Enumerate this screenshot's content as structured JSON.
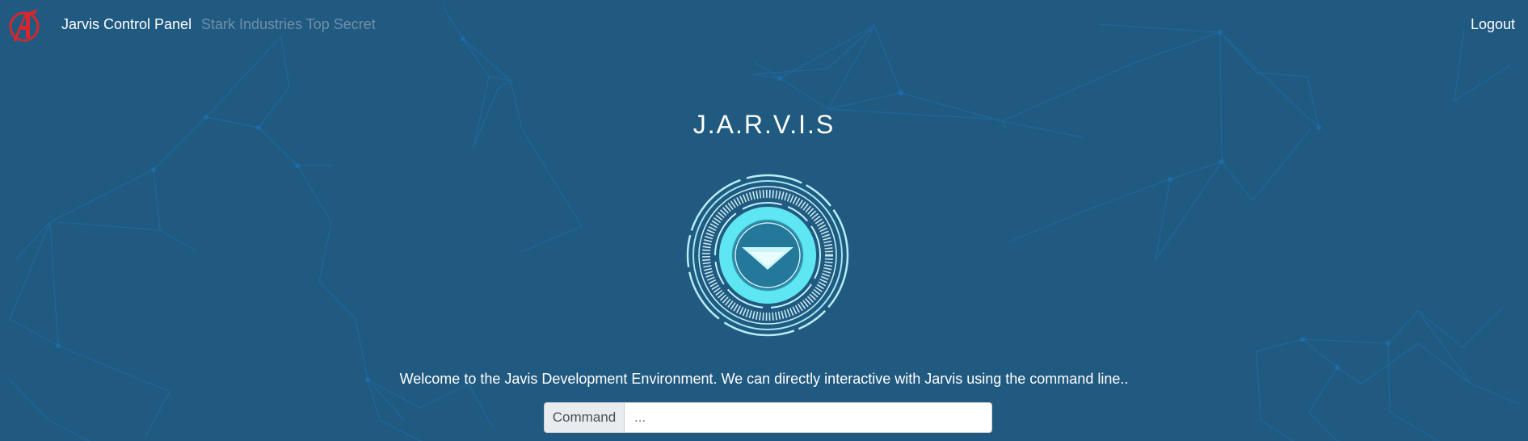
{
  "navbar": {
    "logo_icon": "avengers-logo-icon",
    "title": "Jarvis Control Panel",
    "subtitle": "Stark Industries Top Secret",
    "logout_label": "Logout"
  },
  "main": {
    "title": "J.A.R.V.I.S",
    "reactor_icon": "arc-reactor-icon",
    "welcome_text": "Welcome to the Javis Development Environment. We can directly interactive with Jarvis using the command line..",
    "command": {
      "label": "Command",
      "placeholder": "..."
    }
  },
  "colors": {
    "background": "#215a80",
    "network_lines": "#1a6fb0",
    "reactor_glow": "#5ee6f2",
    "logo_red": "#d7262d"
  }
}
